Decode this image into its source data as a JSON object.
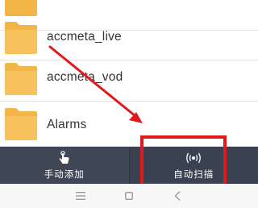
{
  "file_list": {
    "items": [
      {
        "name": "",
        "icon": "folder-icon"
      },
      {
        "name": "accmeta_live",
        "icon": "folder-icon"
      },
      {
        "name": "accmeta_vod",
        "icon": "folder-icon"
      },
      {
        "name": "Alarms",
        "icon": "folder-icon"
      }
    ]
  },
  "bottom_bar": {
    "manual_add_label": "手动添加",
    "manual_add_icon": "hand-tap-icon",
    "auto_scan_label": "自动扫描",
    "auto_scan_icon": "broadcast-icon"
  },
  "nav_bar": {
    "menu_icon": "menu-icon",
    "home_icon": "home-square-icon",
    "back_icon": "back-chevron-icon"
  },
  "colors": {
    "folder": "#f3b548",
    "bottom_bar": "#3f4656",
    "annotation": "#e0191c"
  }
}
